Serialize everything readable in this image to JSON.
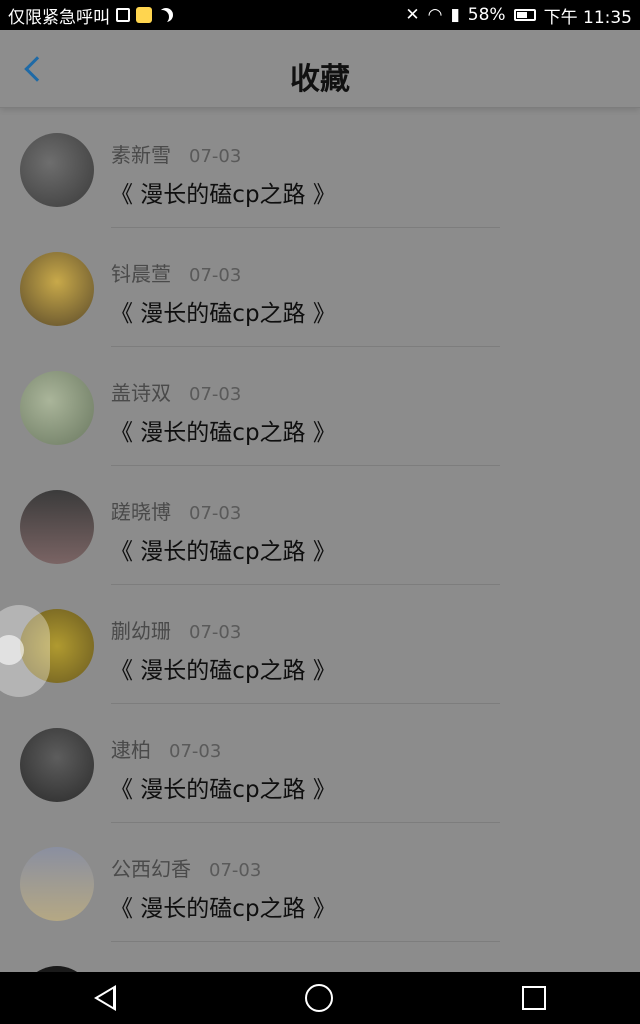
{
  "status_bar": {
    "carrier": "仅限紧急呼叫",
    "battery": "58%",
    "time": "下午 11:35"
  },
  "header": {
    "title": "收藏"
  },
  "items": [
    {
      "name": "素新雪",
      "date": "07-03",
      "title": "《 漫长的磕cp之路 》"
    },
    {
      "name": "钭晨萱",
      "date": "07-03",
      "title": "《 漫长的磕cp之路 》"
    },
    {
      "name": "盖诗双",
      "date": "07-03",
      "title": "《 漫长的磕cp之路 》"
    },
    {
      "name": "蹉晓博",
      "date": "07-03",
      "title": "《 漫长的磕cp之路 》"
    },
    {
      "name": "蒯幼珊",
      "date": "07-03",
      "title": "《 漫长的磕cp之路 》"
    },
    {
      "name": "逮柏",
      "date": "07-03",
      "title": "《 漫长的磕cp之路 》"
    },
    {
      "name": "公西幻香",
      "date": "07-03",
      "title": "《 漫长的磕cp之路 》"
    }
  ]
}
